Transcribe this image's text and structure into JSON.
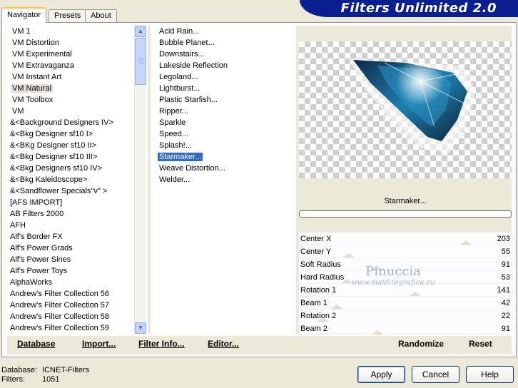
{
  "window": {
    "title": "Filters Unlimited 2.0"
  },
  "tabs": [
    {
      "label": "Navigator"
    },
    {
      "label": "Presets"
    },
    {
      "label": "About"
    }
  ],
  "categories": [
    "VM 1",
    "VM Distortion",
    "VM Experimental",
    "VM Extravaganza",
    "VM Instant Art",
    "VM Natural",
    "VM Toolbox",
    "VM",
    "&<Background Designers IV>",
    "&<Bkg Designer sf10 I>",
    "&<BKg Designer sf10 II>",
    "&<Bkg Designer sf10 III>",
    "&<Bkg Designers sf10 IV>",
    "&<Bkg Kaleidoscope>",
    "&<Sandflower Specials\"v\" >",
    "[AFS IMPORT]",
    "AB Filters 2000",
    "AFH",
    "Alf's Border FX",
    "Alf's Power Grads",
    "Alf's Power Sines",
    "Alf's Power Toys",
    "AlphaWorks",
    "Andrew's Filter Collection 56",
    "Andrew's Filter Collection 57",
    "Andrew's Filter Collection 58",
    "Andrew's Filter Collection 59"
  ],
  "selected_category": "VM Natural",
  "filters": [
    "Acid Rain...",
    "Bubble Planet...",
    "Downstairs...",
    "Lakeside Reflection",
    "Legoland...",
    "Lightburst...",
    "Plastic Starfish...",
    "Ripper...",
    "Sparkle",
    "Speed...",
    "Splash!...",
    "Starmaker...",
    "Weave Distortion...",
    "Welder..."
  ],
  "selected_filter": "Starmaker...",
  "preview": {
    "filter_name": "Starmaker...",
    "progress": 0
  },
  "params": [
    {
      "name": "Center X",
      "value": "203",
      "level": 0.8
    },
    {
      "name": "Center Y",
      "value": "55",
      "level": 0.22
    },
    {
      "name": "Soft Radius",
      "value": "91",
      "level": 0.36
    },
    {
      "name": "Hard Radius",
      "value": "53",
      "level": 0.21
    },
    {
      "name": "Rotation 1",
      "value": "141",
      "level": 0.55
    },
    {
      "name": "Beam 1",
      "value": "42",
      "level": 0.16
    },
    {
      "name": "Rotation 2",
      "value": "22",
      "level": 0.09
    },
    {
      "name": "Beam 2",
      "value": "91",
      "level": 0.36
    }
  ],
  "watermark": {
    "line1": "Pinuccia",
    "line2": "www.maidiregrafica.eu"
  },
  "toolbar": {
    "database": "Database",
    "import": "Import...",
    "filter_info": "Filter Info...",
    "editor": "Editor...",
    "randomize": "Randomize",
    "reset": "Reset"
  },
  "footer": {
    "database_label": "Database:",
    "database_value": "ICNET-Filters",
    "filters_label": "Filters:",
    "filters_value": "1051"
  },
  "buttons": {
    "apply": "Apply",
    "cancel": "Cancel",
    "help": "Help"
  },
  "colors": {
    "banner": "#0a1f8f",
    "selection": "#316ac5",
    "background": "#ece9d8"
  }
}
